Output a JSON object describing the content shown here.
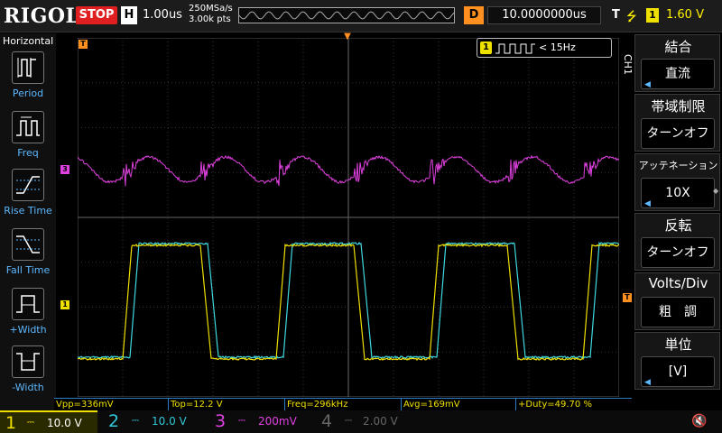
{
  "header": {
    "brand": "RIGOL",
    "run_state": "STOP",
    "timebase_tag": "H",
    "timebase": "1.00us",
    "sample_rate": "250MSa/s",
    "memory_depth": "3.00k pts",
    "delay_tag": "D",
    "delay": "10.0000000us",
    "trigger_tag": "T",
    "trigger_slope_icon": "rising-edge-icon",
    "trigger_source": "1",
    "trigger_level": "1.60 V"
  },
  "left_menu": {
    "title": "Horizontal",
    "items": [
      {
        "label": "Period",
        "icon": "period-icon"
      },
      {
        "label": "Freq",
        "icon": "freq-icon"
      },
      {
        "label": "Rise Time",
        "icon": "rise-time-icon"
      },
      {
        "label": "Fall Time",
        "icon": "fall-time-icon"
      },
      {
        "label": "+Width",
        "icon": "positive-width-icon"
      },
      {
        "label": "-Width",
        "icon": "negative-width-icon"
      }
    ]
  },
  "counter": {
    "source": "1",
    "value": "< 15Hz"
  },
  "right_menu": {
    "channel": "CH1",
    "items": [
      {
        "title": "結合",
        "value": "直流",
        "arrow": true
      },
      {
        "title": "帯域制限",
        "value": "ターンオフ",
        "arrow": false
      },
      {
        "title": "アッテネーション",
        "value": "10X",
        "arrow": true
      },
      {
        "title": "反転",
        "value": "ターンオフ",
        "arrow": false
      },
      {
        "title": "Volts/Div",
        "value": "粗　調",
        "arrow": false
      },
      {
        "title": "単位",
        "value": "[V]",
        "arrow": true
      }
    ]
  },
  "markers": {
    "trigger_pos": "T",
    "trigger_level": "T",
    "ch1": "1",
    "ch3": "3"
  },
  "measurements": [
    {
      "label": "Vpp=336mV",
      "color": "#e040e0"
    },
    {
      "label": "Top=12.2 V",
      "color": "#40d8e0"
    },
    {
      "label": "Freq=296kHz",
      "color": "#f0e000"
    },
    {
      "label": "Avg=169mV",
      "color": "#e040e0"
    },
    {
      "label": "+Duty=49.70 %",
      "color": "#f0e000"
    }
  ],
  "channels": [
    {
      "num": "1",
      "coupling": "DC",
      "scale": "10.0 V",
      "color": "#f0e000"
    },
    {
      "num": "2",
      "coupling": "DC",
      "scale": "10.0 V",
      "color": "#30c8d8"
    },
    {
      "num": "3",
      "coupling": "DC",
      "scale": "200mV",
      "color": "#e040e0"
    },
    {
      "num": "4",
      "coupling": "DC",
      "scale": "2.00 V",
      "color": "#666666"
    }
  ],
  "colors": {
    "ch1": "#f0e000",
    "ch2": "#40d8e0",
    "ch3": "#e040e0",
    "trigger": "#ff9020"
  }
}
